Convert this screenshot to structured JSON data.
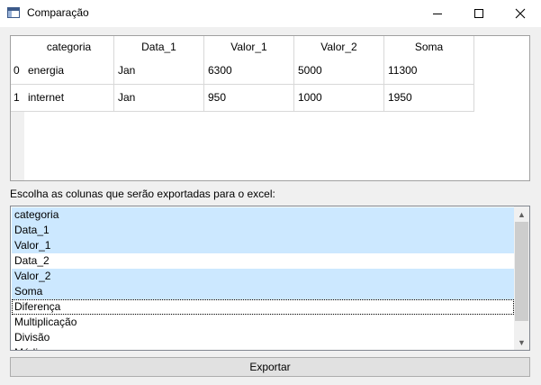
{
  "window": {
    "title": "Comparação",
    "icon": "app-window-icon"
  },
  "table": {
    "columns": [
      "categoria",
      "Data_1",
      "Valor_1",
      "Valor_2",
      "Soma"
    ],
    "row_headers": [
      "0",
      "1"
    ],
    "rows": [
      [
        "energia",
        "Jan",
        "6300",
        "5000",
        "11300"
      ],
      [
        "internet",
        "Jan",
        "950",
        "1000",
        "1950"
      ]
    ]
  },
  "prompt_label": "Escolha as colunas que serão exportadas para o excel:",
  "column_list": {
    "items": [
      {
        "label": "categoria",
        "selected": true
      },
      {
        "label": "Data_1",
        "selected": true
      },
      {
        "label": "Valor_1",
        "selected": true
      },
      {
        "label": "Data_2",
        "selected": false
      },
      {
        "label": "Valor_2",
        "selected": true
      },
      {
        "label": "Soma",
        "selected": true
      },
      {
        "label": "Diferença",
        "selected": false,
        "focused": true
      },
      {
        "label": "Multiplicação",
        "selected": false
      },
      {
        "label": "Divisão",
        "selected": false
      },
      {
        "label": "Média",
        "selected": false
      }
    ],
    "selection_color": "#cce8ff"
  },
  "export_button": {
    "label": "Exportar"
  }
}
